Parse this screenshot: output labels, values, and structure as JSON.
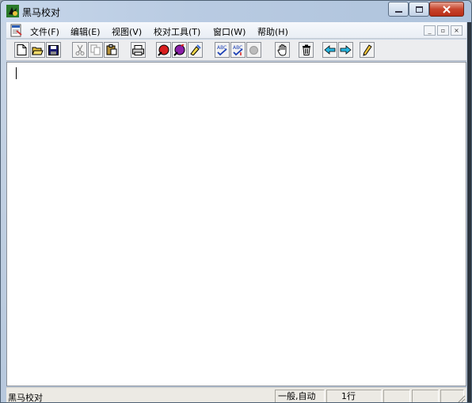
{
  "window": {
    "title": "黑马校对"
  },
  "menubar": {
    "items": [
      "文件(F)",
      "编辑(E)",
      "视图(V)",
      "校对工具(T)",
      "窗口(W)",
      "帮助(H)"
    ]
  },
  "toolbar": {
    "buttons": [
      "new-icon",
      "open-icon",
      "save-icon",
      "cut-icon",
      "copy-icon",
      "paste-icon",
      "print-icon",
      "proofread-red-icon",
      "proofread-purple-icon",
      "highlighter-icon",
      "spellcheck-icon",
      "spellcheck-next-icon",
      "record-icon",
      "hand-icon",
      "delete-icon",
      "arrow-left-icon",
      "arrow-right-icon",
      "pencil-icon"
    ]
  },
  "statusbar": {
    "left": "黑马校对",
    "mode": "一般,自动",
    "line": "1行"
  },
  "colors": {
    "close": "#c7452d",
    "accent": "#1f6fd1"
  }
}
